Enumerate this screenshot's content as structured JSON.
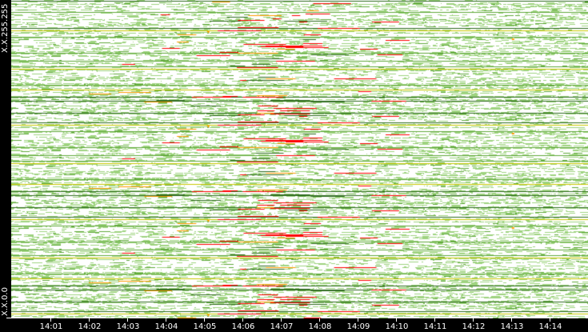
{
  "chart_data": {
    "type": "heatmap",
    "title": "",
    "xlabel": "",
    "ylabel": "",
    "x_ticks": [
      "14:01",
      "14:02",
      "14:03",
      "14:04",
      "14:05",
      "14:06",
      "14:07",
      "14:08",
      "14:09",
      "14:10",
      "14:11",
      "14:12",
      "14:13",
      "14:14"
    ],
    "y_labels": {
      "top": "X.X.255.255",
      "bottom": "X.X.0.0"
    },
    "colors": {
      "background": "#ffffff",
      "low": "#9ed37f",
      "medium": "#5fa83a",
      "dark": "#2e6b1e",
      "high": "#ff0000",
      "warn": "#ff9900",
      "yellow": "#c8c800"
    },
    "hotspot_time_range": [
      "14:05",
      "14:09"
    ]
  }
}
